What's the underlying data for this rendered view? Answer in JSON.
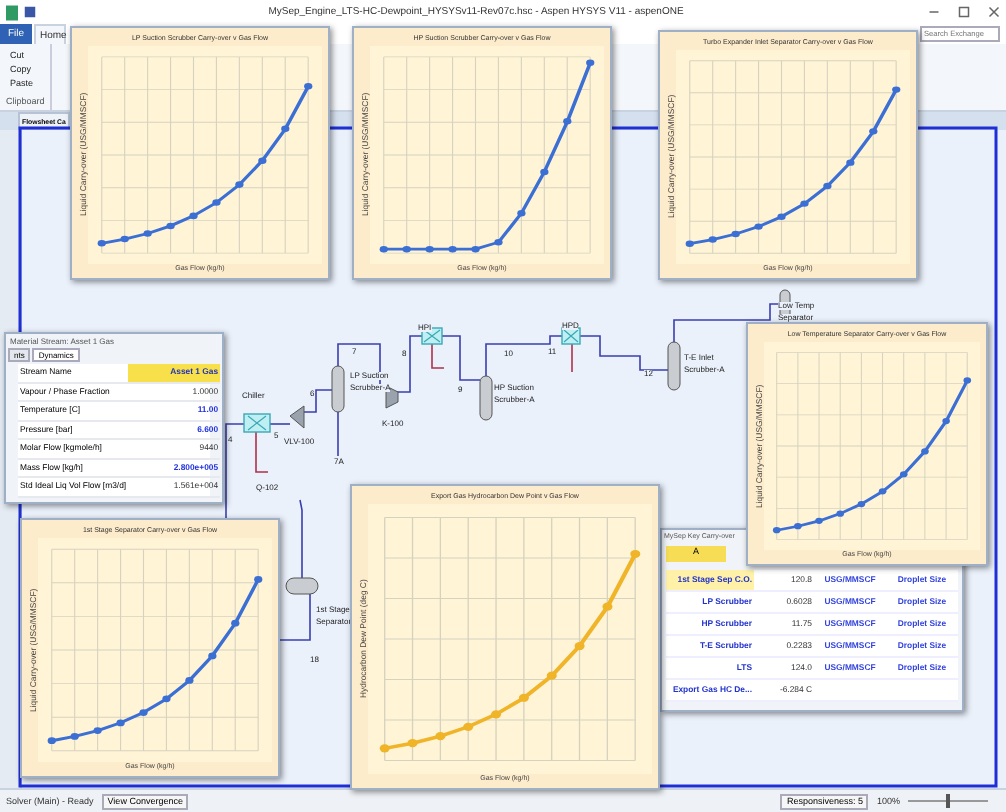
{
  "window": {
    "title": "MySep_Engine_LTS-HC-Dewpoint_HYSYSv11-Rev07c.hsc - Aspen HYSYS V11 - aspenONE"
  },
  "search": {
    "placeholder": "Search Exchange"
  },
  "ribbon": {
    "tabs": [
      {
        "label": "File",
        "selected": false
      },
      {
        "label": "Home",
        "selected": true
      }
    ],
    "commands": [
      "Cut",
      "Copy",
      "Paste"
    ],
    "group_label": "Clipboard"
  },
  "document_tab": {
    "label": "Flowsheet Ca"
  },
  "flowsheet": {
    "labels": [
      "4",
      "5",
      "Chiller",
      "Q-102",
      "VLV-100",
      "6",
      "7",
      "LP Suction",
      "Scrubber-A",
      "7A",
      "8",
      "HPI",
      "K-100",
      "9",
      "HP Suction",
      "Scrubber-A",
      "10",
      "11",
      "HPD",
      "12",
      "T-E Inlet",
      "Scrubber-A",
      "Low Temp",
      "Separator",
      "1st Stage",
      "Separator",
      "18"
    ]
  },
  "charts": [
    {
      "title": "LP Suction Scrubber Carry-over v Gas Flow",
      "xlabel": "Gas Flow (kg/h)",
      "ylabel": "Liquid Carry-over (USG/MMSCF)",
      "kind": "rising",
      "color": "#3b6fd4"
    },
    {
      "title": "HP Suction Scrubber Carry-over v Gas Flow",
      "xlabel": "Gas Flow (kg/h)",
      "ylabel": "Liquid Carry-over (USG/MMSCF)",
      "kind": "knee",
      "color": "#3b6fd4"
    },
    {
      "title": "Turbo Expander Inlet Separator Carry-over v Gas Flow",
      "xlabel": "Gas Flow (kg/h)",
      "ylabel": "Liquid Carry-over (USG/MMSCF)",
      "kind": "rising",
      "color": "#3b6fd4"
    },
    {
      "title": "Low Temperature Separator Carry-over v Gas Flow",
      "xlabel": "Gas Flow (kg/h)",
      "ylabel": "Liquid Carry-over (USG/MMSCF)",
      "kind": "rising",
      "color": "#3b6fd4"
    },
    {
      "title": "1st Stage Separator Carry-over v Gas Flow",
      "xlabel": "Gas Flow (kg/h)",
      "ylabel": "Liquid Carry-over (USG/MMSCF)",
      "kind": "rising",
      "color": "#3b6fd4"
    },
    {
      "title": "Export Gas Hydrocarbon Dew Point v Gas Flow",
      "xlabel": "Gas Flow (kg/h)",
      "ylabel": "Hydrocarbon Dew Point (deg C)",
      "kind": "rising",
      "color": "#f0b429"
    }
  ],
  "stream_window": {
    "title": "Material Stream: Asset 1 Gas",
    "tabs": [
      {
        "label": "nts",
        "selected": false
      },
      {
        "label": "Dynamics",
        "selected": true
      }
    ],
    "rows": [
      {
        "name": "Stream Name",
        "value": "Asset 1 Gas",
        "kind": "name"
      },
      {
        "name": "Vapour / Phase Fraction",
        "value": "1.0000",
        "kind": "calc"
      },
      {
        "name": "Temperature [C]",
        "value": "11.00",
        "kind": "spec"
      },
      {
        "name": "Pressure [bar]",
        "value": "6.600",
        "kind": "spec"
      },
      {
        "name": "Molar Flow [kgmole/h]",
        "value": "9440",
        "kind": "calc"
      },
      {
        "name": "Mass Flow [kg/h]",
        "value": "2.800e+005",
        "kind": "spec"
      },
      {
        "name": "Std Ideal Liq Vol Flow [m3/d]",
        "value": "1.561e+004",
        "kind": "calc"
      }
    ]
  },
  "spreadsheet": {
    "title": "MySep Key Carry-over",
    "column": "A",
    "rows": [
      {
        "label": "1st Stage Sep C.O.",
        "value": "120.8",
        "unit": "USG/MMSCF",
        "basis": "Droplet Size",
        "selected": true
      },
      {
        "label": "LP Scrubber",
        "value": "0.6028",
        "unit": "USG/MMSCF",
        "basis": "Droplet Size",
        "selected": false
      },
      {
        "label": "HP Scrubber",
        "value": "11.75",
        "unit": "USG/MMSCF",
        "basis": "Droplet Size",
        "selected": false
      },
      {
        "label": "T-E Scrubber",
        "value": "0.2283",
        "unit": "USG/MMSCF",
        "basis": "Droplet Size",
        "selected": false
      },
      {
        "label": "LTS",
        "value": "124.0",
        "unit": "USG/MMSCF",
        "basis": "Droplet Size",
        "selected": false
      },
      {
        "label": "Export Gas HC De...",
        "value": "-6.284 C",
        "unit": "",
        "basis": "",
        "selected": false
      }
    ]
  },
  "status_bar": {
    "solver": "Solver (Main) - Ready",
    "button": "View Convergence",
    "responsiveness": "Responsiveness: 5",
    "zoom_text": "100%",
    "zoom": {
      "level": 0.5
    }
  }
}
